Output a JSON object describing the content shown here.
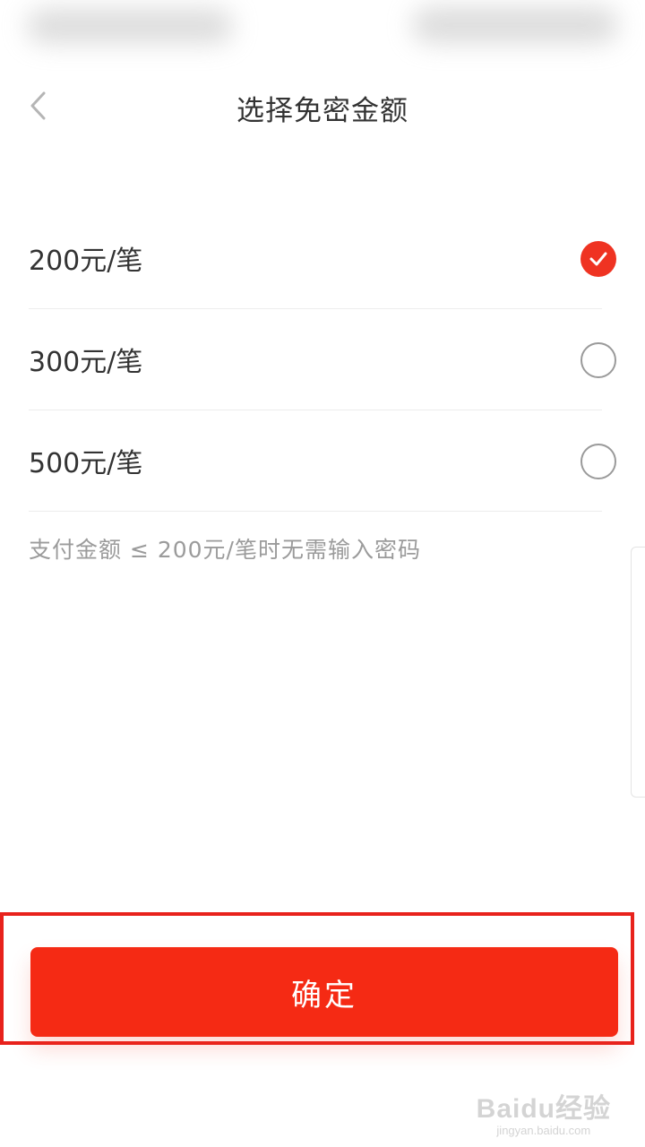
{
  "header": {
    "title": "选择免密金额"
  },
  "options": [
    {
      "label": "200元/笔",
      "selected": true
    },
    {
      "label": "300元/笔",
      "selected": false
    },
    {
      "label": "500元/笔",
      "selected": false
    }
  ],
  "hint": "支付金额 ≤ 200元/笔时无需输入密码",
  "confirm_label": "确定",
  "watermark": {
    "main": "Baidu经验",
    "sub": "jingyan.baidu.com"
  },
  "colors": {
    "accent": "#f52a14",
    "highlight_border": "#e8221c"
  },
  "icons": {
    "back": "chevron-left-icon",
    "check": "check-icon",
    "radio": "radio-empty-icon"
  }
}
